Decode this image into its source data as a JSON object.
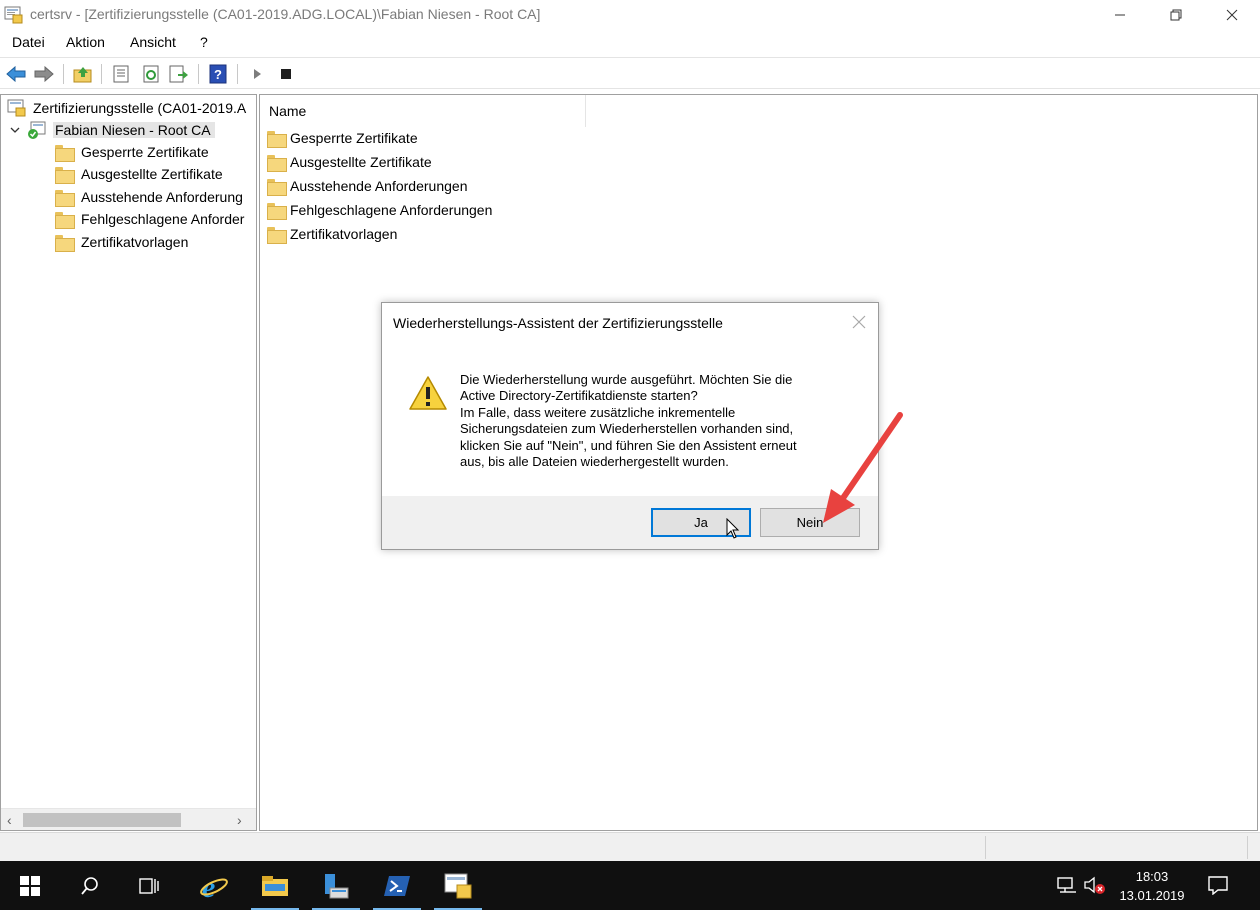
{
  "window": {
    "title": "certsrv - [Zertifizierungsstelle (CA01-2019.ADG.LOCAL)\\Fabian Niesen - Root CA]"
  },
  "menu": {
    "items": [
      "Datei",
      "Aktion",
      "Ansicht",
      "?"
    ]
  },
  "toolbar": {
    "buttons": [
      "back-icon",
      "forward-icon",
      "up-folder-icon",
      "properties-icon",
      "refresh-icon",
      "export-list-icon",
      "help-icon",
      "start-service-icon",
      "stop-service-icon"
    ]
  },
  "tree": {
    "root": "Zertifizierungsstelle (CA01-2019.A",
    "ca": "Fabian Niesen - Root CA",
    "children": [
      "Gesperrte Zertifikate",
      "Ausgestellte Zertifikate",
      "Ausstehende Anforderung",
      "Fehlgeschlagene Anforder",
      "Zertifikatvorlagen"
    ]
  },
  "list": {
    "column_header": "Name",
    "items": [
      "Gesperrte Zertifikate",
      "Ausgestellte Zertifikate",
      "Ausstehende Anforderungen",
      "Fehlgeschlagene Anforderungen",
      "Zertifikatvorlagen"
    ]
  },
  "dialog": {
    "title": "Wiederherstellungs-Assistent der Zertifizierungsstelle",
    "message_lines": [
      "Die Wiederherstellung wurde ausgeführt. Möchten Sie die",
      "Active Directory-Zertifikatdienste starten?",
      "Im Falle, dass weitere zusätzliche inkrementelle",
      "Sicherungsdateien zum Wiederherstellen vorhanden sind,",
      "klicken Sie auf \"Nein\", und führen Sie den Assistent erneut",
      "aus, bis alle Dateien wiederhergestellt wurden."
    ],
    "yes_label": "Ja",
    "no_label": "Nein",
    "icon": "warning-icon"
  },
  "annotation": {
    "color": "#e8423f",
    "target": "Nein"
  },
  "taskbar": {
    "apps": [
      "start-icon",
      "search-icon",
      "task-view-icon",
      "internet-explorer-icon",
      "file-explorer-icon",
      "server-manager-icon",
      "powershell-icon",
      "certsrv-icon"
    ],
    "time": "18:03",
    "date": "13.01.2019"
  },
  "colors": {
    "accent": "#0078d7",
    "taskbar": "#101010",
    "folder": "#f6d77d"
  }
}
